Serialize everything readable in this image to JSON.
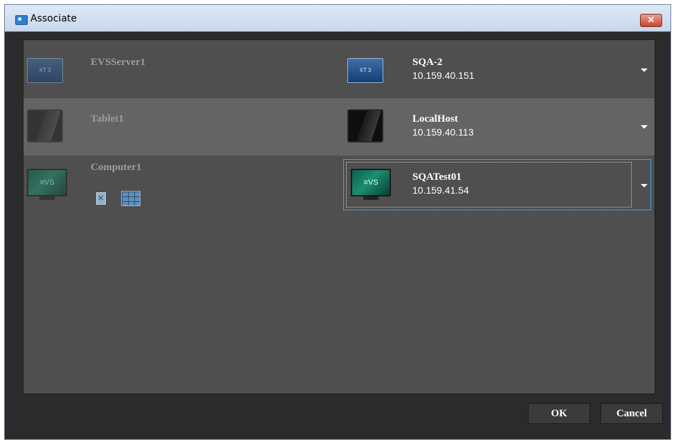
{
  "window": {
    "title": "Associate",
    "close_label": "✕"
  },
  "rows": [
    {
      "source": "EVSServer1",
      "target_name": "SQA-2",
      "target_ip": "10.159.40.151",
      "image_text": "XT 3"
    },
    {
      "source": "Tablet1",
      "target_name": "LocalHost",
      "target_ip": "10.159.40.113"
    },
    {
      "source": "Computer1",
      "target_name": "SQATest01",
      "target_ip": "10.159.41.54",
      "image_text": "≡VS"
    }
  ],
  "buttons": {
    "ok": "OK",
    "cancel": "Cancel"
  }
}
